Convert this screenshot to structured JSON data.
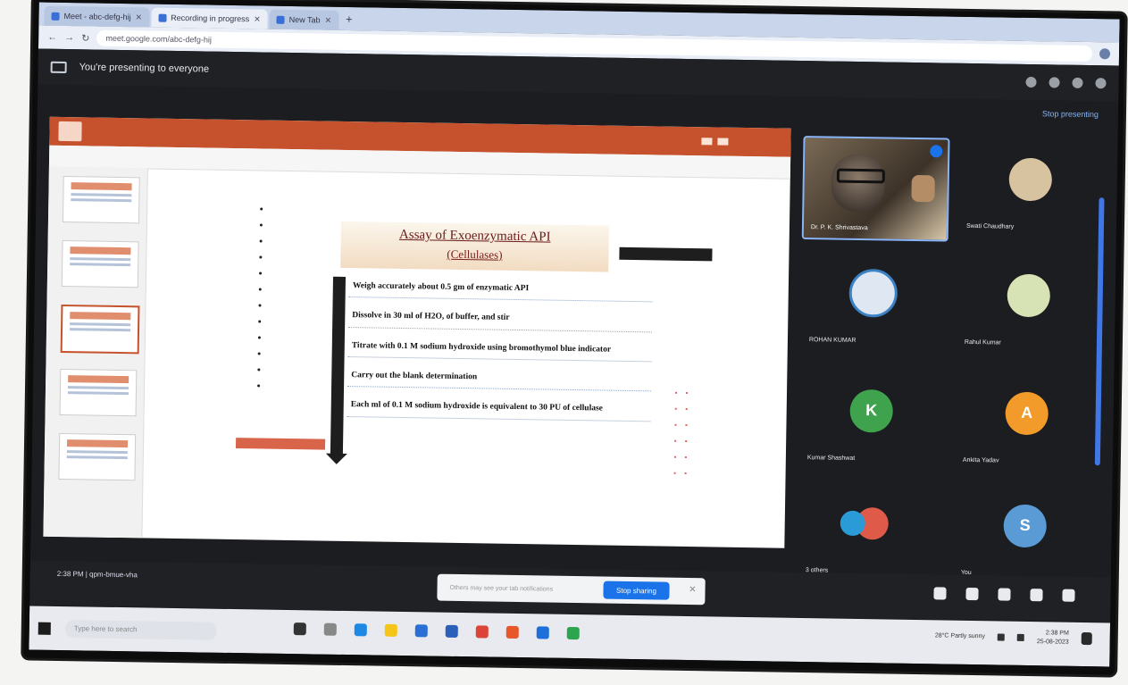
{
  "browser": {
    "tabs": [
      {
        "label": "Meet - abc-defg-hij",
        "active": false
      },
      {
        "label": "Recording in progress",
        "active": true
      },
      {
        "label": "New Tab",
        "active": false
      }
    ],
    "url": "meet.google.com/abc-defg-hij"
  },
  "meet": {
    "presenting_text": "You're presenting to everyone",
    "stop_presenting": "Stop presenting",
    "meeting_code": "2:38 PM | qpm-bmue-vha",
    "notification": {
      "text": "Others may see your tab notifications",
      "button": "Stop sharing"
    }
  },
  "slide": {
    "title_line1": "Assay of Exoenzymatic API",
    "title_line2": "(Cellulases)",
    "bullets": [
      "Weigh accurately about 0.5 gm of enzymatic API",
      "Dissolve in 30 ml of H2O, of buffer, and stir",
      "Titrate with 0.1 M sodium hydroxide using bromothymol blue indicator",
      "Carry out the blank determination",
      "Each ml of 0.1 M sodium hydroxide is equivalent to 30 PU of cellulase"
    ]
  },
  "participants": [
    {
      "name": "Dr. P. K. Shrivastava",
      "type": "video"
    },
    {
      "name": "Swati Chaudhary",
      "avatar_color": "#d7c3a0",
      "initial": ""
    },
    {
      "name": "ROHAN KUMAR",
      "avatar_color": "#dfe8f2",
      "initial": ""
    },
    {
      "name": "Rahul Kumar",
      "avatar_color": "#d7e3b5",
      "initial": ""
    },
    {
      "name": "Kumar Shashwat",
      "avatar_color": "#3fa34d",
      "initial": "K"
    },
    {
      "name": "Ankita Yadav",
      "avatar_color": "#f29b2a",
      "initial": "A"
    },
    {
      "name": "3 others",
      "avatar_color": "#e05a4a",
      "initial": ""
    },
    {
      "name": "You",
      "avatar_color": "#5b9bd5",
      "initial": "S"
    }
  ],
  "taskbar": {
    "search_placeholder": "Type here to search",
    "weather": "28°C Partly sunny",
    "time": "2:38 PM",
    "date": "25-08-2023"
  },
  "colors": {
    "ribbon": "#c5522d",
    "meet_bg": "#202124",
    "accent": "#1a73e8"
  }
}
